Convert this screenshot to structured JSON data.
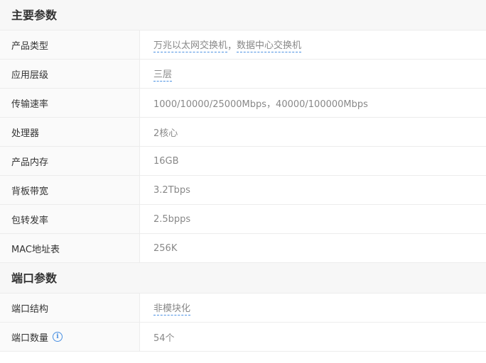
{
  "sections": [
    {
      "title": "主要参数",
      "rows": [
        {
          "label": "产品类型",
          "values": [
            "万兆以太网交换机",
            "数据中心交换机"
          ],
          "separator": "，"
        },
        {
          "label": "应用层级",
          "values": [
            "三层"
          ]
        },
        {
          "label": "传输速率",
          "value": "1000/10000/25000Mbps，40000/100000Mbps"
        },
        {
          "label": "处理器",
          "value": "2核心"
        },
        {
          "label": "产品内存",
          "value": "16GB"
        },
        {
          "label": "背板带宽",
          "value": "3.2Tbps"
        },
        {
          "label": "包转发率",
          "value": "2.5bpps"
        },
        {
          "label": "MAC地址表",
          "value": "256K"
        }
      ]
    },
    {
      "title": "端口参数",
      "rows": [
        {
          "label": "端口结构",
          "values": [
            "非模块化"
          ]
        },
        {
          "label": "端口数量",
          "value": "54个",
          "icon": "info-icon"
        }
      ]
    }
  ]
}
